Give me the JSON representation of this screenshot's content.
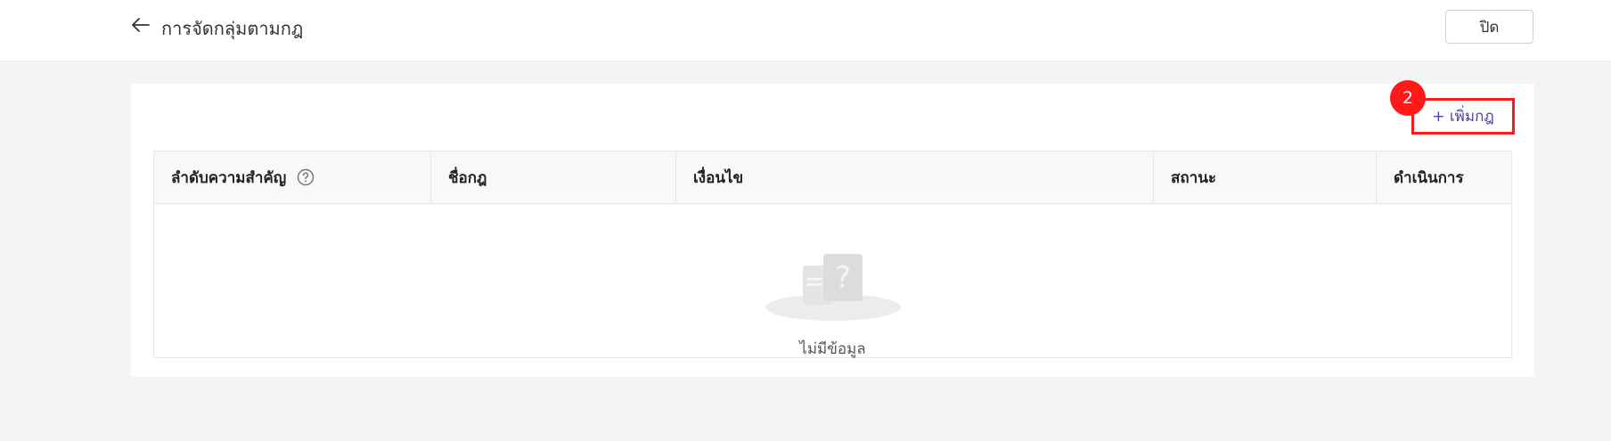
{
  "header": {
    "title": "การจัดกลุ่มตามกฎ",
    "close_label": "ปิด"
  },
  "toolbar": {
    "add_rule_label": "+ เพิ่มกฎ",
    "step_badge": "2"
  },
  "table": {
    "columns": [
      "ลำดับความสำคัญ",
      "ชื่อกฎ",
      "เงื่อนไข",
      "สถานะ",
      "ดำเนินการ"
    ],
    "empty_text": "ไม่มีข้อมูล"
  },
  "icons": {
    "back": "arrow-left-icon",
    "help": "question-circle-icon",
    "empty": "empty-document-icon"
  },
  "colors": {
    "accent": "#4b3fae",
    "highlight": "#ff1a1a",
    "page_bg": "#f4f4f4"
  }
}
